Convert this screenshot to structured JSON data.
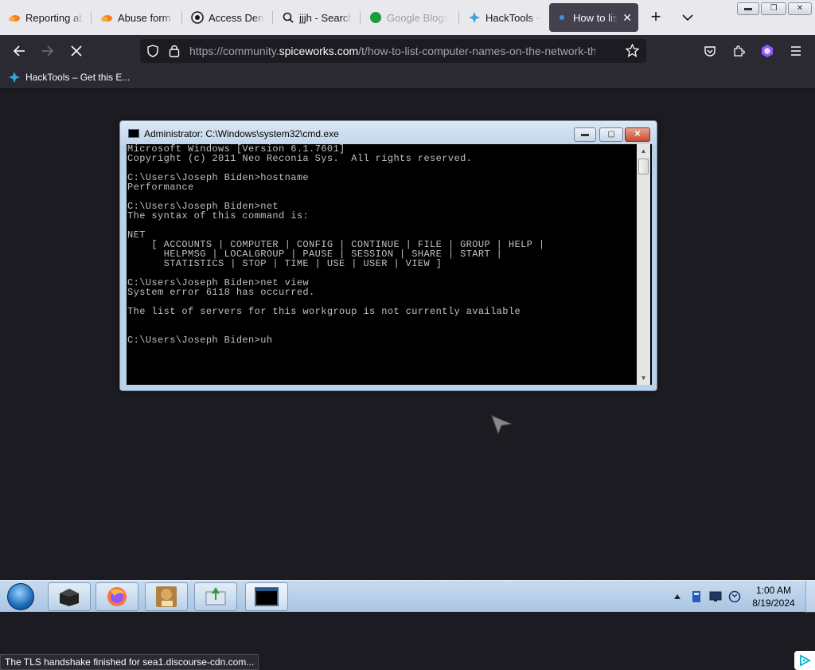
{
  "browser": {
    "tabs": [
      {
        "label": "Reporting abuse",
        "icon": "cloudflare-icon"
      },
      {
        "label": "Abuse form | Cloudflare",
        "icon": "cloudflare-icon"
      },
      {
        "label": "Access Denied",
        "icon": "access-icon"
      },
      {
        "label": "jjjh - Search",
        "icon": "search-icon"
      },
      {
        "label": "Google Blogs",
        "icon": "green-circle-icon"
      },
      {
        "label": "HackTools – Get this",
        "icon": "hacktools-icon"
      },
      {
        "label": "How to list computer",
        "icon": "spiceworks-icon",
        "active": true
      }
    ],
    "url_prefix": "https://community.",
    "url_host": "spiceworks.com",
    "url_path": "/t/how-to-list-computer-names-on-the-network-thro",
    "bookmark": "HackTools – Get this E...",
    "status_text": "The TLS handshake finished for sea1.discourse-cdn.com..."
  },
  "cmd": {
    "title": "Administrator: C:\\Windows\\system32\\cmd.exe",
    "lines": [
      "Microsoft Windows [Version 6.1.7601]",
      "Copyright (c) 2011 Neo Reconia Sys.  All rights reserved.",
      "",
      "C:\\Users\\Joseph Biden>hostname",
      "Performance",
      "",
      "C:\\Users\\Joseph Biden>net",
      "The syntax of this command is:",
      "",
      "NET",
      "    [ ACCOUNTS | COMPUTER | CONFIG | CONTINUE | FILE | GROUP | HELP |",
      "      HELPMSG | LOCALGROUP | PAUSE | SESSION | SHARE | START |",
      "      STATISTICS | STOP | TIME | USE | USER | VIEW ]",
      "",
      "C:\\Users\\Joseph Biden>net view",
      "System error 6118 has occurred.",
      "",
      "The list of servers for this workgroup is not currently available",
      "",
      "",
      "C:\\Users\\Joseph Biden>uh"
    ]
  },
  "taskbar": {
    "time": "1:00 AM",
    "date": "8/19/2024",
    "apps": [
      "box-app",
      "firefox",
      "boxer-game",
      "installer",
      "cmd"
    ]
  },
  "colors": {
    "tab_active": "#42414d",
    "navbar": "#2b2a33",
    "content_bg": "#1c1b22",
    "console_text": "#c0c0c0"
  }
}
